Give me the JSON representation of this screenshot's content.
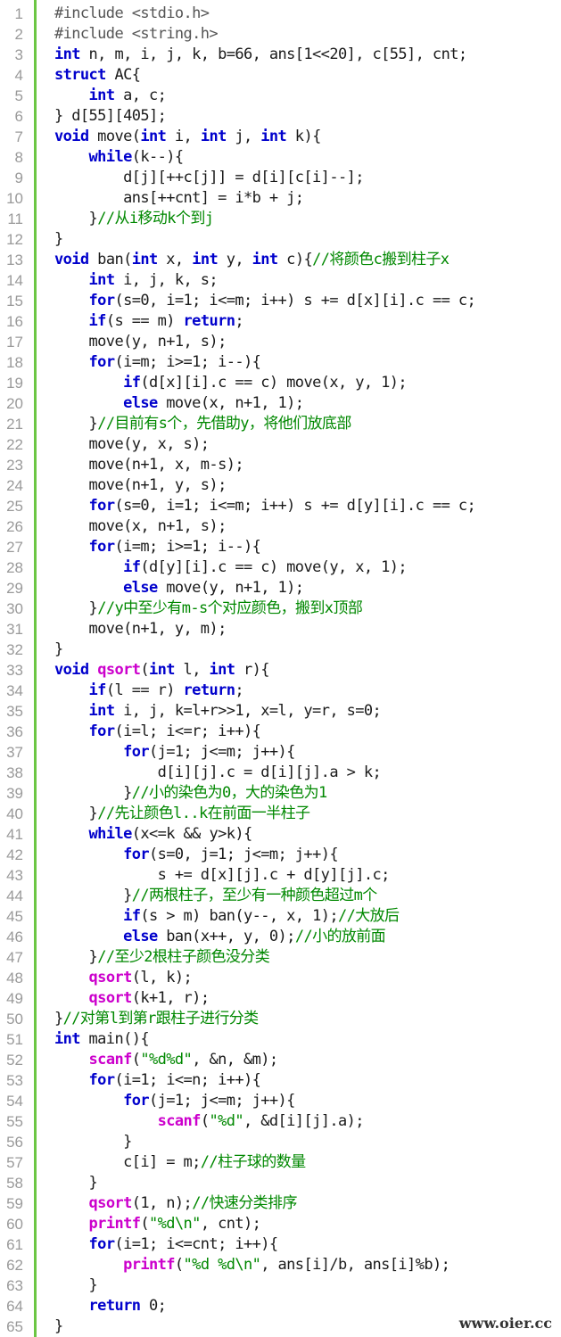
{
  "watermark": "www.oier.cc",
  "lines": [
    {
      "n": "1",
      "t": [
        {
          "c": "pp",
          "s": "#include <stdio.h>"
        }
      ]
    },
    {
      "n": "2",
      "t": [
        {
          "c": "pp",
          "s": "#include <string.h>"
        }
      ]
    },
    {
      "n": "3",
      "t": [
        {
          "c": "kw",
          "s": "int"
        },
        {
          "c": "",
          "s": " n, m, i, j, k, b=66, ans[1<<20], c[55], cnt;"
        }
      ]
    },
    {
      "n": "4",
      "t": [
        {
          "c": "kw",
          "s": "struct"
        },
        {
          "c": "",
          "s": " AC{"
        }
      ]
    },
    {
      "n": "5",
      "t": [
        {
          "c": "",
          "s": "    "
        },
        {
          "c": "kw",
          "s": "int"
        },
        {
          "c": "",
          "s": " a, c;"
        }
      ]
    },
    {
      "n": "6",
      "t": [
        {
          "c": "",
          "s": "} d[55][405];"
        }
      ]
    },
    {
      "n": "7",
      "t": [
        {
          "c": "kw",
          "s": "void"
        },
        {
          "c": "",
          "s": " move("
        },
        {
          "c": "kw",
          "s": "int"
        },
        {
          "c": "",
          "s": " i, "
        },
        {
          "c": "kw",
          "s": "int"
        },
        {
          "c": "",
          "s": " j, "
        },
        {
          "c": "kw",
          "s": "int"
        },
        {
          "c": "",
          "s": " k){"
        }
      ]
    },
    {
      "n": "8",
      "t": [
        {
          "c": "",
          "s": "    "
        },
        {
          "c": "kw",
          "s": "while"
        },
        {
          "c": "",
          "s": "(k--){"
        }
      ]
    },
    {
      "n": "9",
      "t": [
        {
          "c": "",
          "s": "        d[j][++c[j]] = d[i][c[i]--];"
        }
      ]
    },
    {
      "n": "10",
      "t": [
        {
          "c": "",
          "s": "        ans[++cnt] = i*b + j;"
        }
      ]
    },
    {
      "n": "11",
      "t": [
        {
          "c": "",
          "s": "    }"
        },
        {
          "c": "cm",
          "s": "//从i移动k个到j"
        }
      ]
    },
    {
      "n": "12",
      "t": [
        {
          "c": "",
          "s": "}"
        }
      ]
    },
    {
      "n": "13",
      "t": [
        {
          "c": "kw",
          "s": "void"
        },
        {
          "c": "",
          "s": " ban("
        },
        {
          "c": "kw",
          "s": "int"
        },
        {
          "c": "",
          "s": " x, "
        },
        {
          "c": "kw",
          "s": "int"
        },
        {
          "c": "",
          "s": " y, "
        },
        {
          "c": "kw",
          "s": "int"
        },
        {
          "c": "",
          "s": " c){"
        },
        {
          "c": "cm",
          "s": "//将颜色c搬到柱子x"
        }
      ]
    },
    {
      "n": "14",
      "t": [
        {
          "c": "",
          "s": "    "
        },
        {
          "c": "kw",
          "s": "int"
        },
        {
          "c": "",
          "s": " i, j, k, s;"
        }
      ]
    },
    {
      "n": "15",
      "t": [
        {
          "c": "",
          "s": "    "
        },
        {
          "c": "kw",
          "s": "for"
        },
        {
          "c": "",
          "s": "(s=0, i=1; i<=m; i++) s += d[x][i].c == c;"
        }
      ]
    },
    {
      "n": "16",
      "t": [
        {
          "c": "",
          "s": "    "
        },
        {
          "c": "kw",
          "s": "if"
        },
        {
          "c": "",
          "s": "(s == m) "
        },
        {
          "c": "kw",
          "s": "return"
        },
        {
          "c": "",
          "s": ";"
        }
      ]
    },
    {
      "n": "17",
      "t": [
        {
          "c": "",
          "s": "    move(y, n+1, s);"
        }
      ]
    },
    {
      "n": "18",
      "t": [
        {
          "c": "",
          "s": "    "
        },
        {
          "c": "kw",
          "s": "for"
        },
        {
          "c": "",
          "s": "(i=m; i>=1; i--){"
        }
      ]
    },
    {
      "n": "19",
      "t": [
        {
          "c": "",
          "s": "        "
        },
        {
          "c": "kw",
          "s": "if"
        },
        {
          "c": "",
          "s": "(d[x][i].c == c) move(x, y, 1);"
        }
      ]
    },
    {
      "n": "20",
      "t": [
        {
          "c": "",
          "s": "        "
        },
        {
          "c": "kw",
          "s": "else"
        },
        {
          "c": "",
          "s": " move(x, n+1, 1);"
        }
      ]
    },
    {
      "n": "21",
      "t": [
        {
          "c": "",
          "s": "    }"
        },
        {
          "c": "cm",
          "s": "//目前有s个，先借助y，将他们放底部"
        }
      ]
    },
    {
      "n": "22",
      "t": [
        {
          "c": "",
          "s": "    move(y, x, s);"
        }
      ]
    },
    {
      "n": "23",
      "t": [
        {
          "c": "",
          "s": "    move(n+1, x, m-s);"
        }
      ]
    },
    {
      "n": "24",
      "t": [
        {
          "c": "",
          "s": "    move(n+1, y, s);"
        }
      ]
    },
    {
      "n": "25",
      "t": [
        {
          "c": "",
          "s": "    "
        },
        {
          "c": "kw",
          "s": "for"
        },
        {
          "c": "",
          "s": "(s=0, i=1; i<=m; i++) s += d[y][i].c == c;"
        }
      ]
    },
    {
      "n": "26",
      "t": [
        {
          "c": "",
          "s": "    move(x, n+1, s);"
        }
      ]
    },
    {
      "n": "27",
      "t": [
        {
          "c": "",
          "s": "    "
        },
        {
          "c": "kw",
          "s": "for"
        },
        {
          "c": "",
          "s": "(i=m; i>=1; i--){"
        }
      ]
    },
    {
      "n": "28",
      "t": [
        {
          "c": "",
          "s": "        "
        },
        {
          "c": "kw",
          "s": "if"
        },
        {
          "c": "",
          "s": "(d[y][i].c == c) move(y, x, 1);"
        }
      ]
    },
    {
      "n": "29",
      "t": [
        {
          "c": "",
          "s": "        "
        },
        {
          "c": "kw",
          "s": "else"
        },
        {
          "c": "",
          "s": " move(y, n+1, 1);"
        }
      ]
    },
    {
      "n": "30",
      "t": [
        {
          "c": "",
          "s": "    }"
        },
        {
          "c": "cm",
          "s": "//y中至少有m-s个对应颜色，搬到x顶部"
        }
      ]
    },
    {
      "n": "31",
      "t": [
        {
          "c": "",
          "s": "    move(n+1, y, m);"
        }
      ]
    },
    {
      "n": "32",
      "t": [
        {
          "c": "",
          "s": "}"
        }
      ]
    },
    {
      "n": "33",
      "t": [
        {
          "c": "kw",
          "s": "void"
        },
        {
          "c": "",
          "s": " "
        },
        {
          "c": "fn",
          "s": "qsort"
        },
        {
          "c": "",
          "s": "("
        },
        {
          "c": "kw",
          "s": "int"
        },
        {
          "c": "",
          "s": " l, "
        },
        {
          "c": "kw",
          "s": "int"
        },
        {
          "c": "",
          "s": " r){"
        }
      ]
    },
    {
      "n": "34",
      "t": [
        {
          "c": "",
          "s": "    "
        },
        {
          "c": "kw",
          "s": "if"
        },
        {
          "c": "",
          "s": "(l == r) "
        },
        {
          "c": "kw",
          "s": "return"
        },
        {
          "c": "",
          "s": ";"
        }
      ]
    },
    {
      "n": "35",
      "t": [
        {
          "c": "",
          "s": "    "
        },
        {
          "c": "kw",
          "s": "int"
        },
        {
          "c": "",
          "s": " i, j, k=l+r>>1, x=l, y=r, s=0;"
        }
      ]
    },
    {
      "n": "36",
      "t": [
        {
          "c": "",
          "s": "    "
        },
        {
          "c": "kw",
          "s": "for"
        },
        {
          "c": "",
          "s": "(i=l; i<=r; i++){"
        }
      ]
    },
    {
      "n": "37",
      "t": [
        {
          "c": "",
          "s": "        "
        },
        {
          "c": "kw",
          "s": "for"
        },
        {
          "c": "",
          "s": "(j=1; j<=m; j++){"
        }
      ]
    },
    {
      "n": "38",
      "t": [
        {
          "c": "",
          "s": "            d[i][j].c = d[i][j].a > k;"
        }
      ]
    },
    {
      "n": "39",
      "t": [
        {
          "c": "",
          "s": "        }"
        },
        {
          "c": "cm",
          "s": "//小的染色为0，大的染色为1"
        }
      ]
    },
    {
      "n": "40",
      "t": [
        {
          "c": "",
          "s": "    }"
        },
        {
          "c": "cm",
          "s": "//先让颜色l..k在前面一半柱子"
        }
      ]
    },
    {
      "n": "41",
      "t": [
        {
          "c": "",
          "s": "    "
        },
        {
          "c": "kw",
          "s": "while"
        },
        {
          "c": "",
          "s": "(x<=k && y>k){"
        }
      ]
    },
    {
      "n": "42",
      "t": [
        {
          "c": "",
          "s": "        "
        },
        {
          "c": "kw",
          "s": "for"
        },
        {
          "c": "",
          "s": "(s=0, j=1; j<=m; j++){"
        }
      ]
    },
    {
      "n": "43",
      "t": [
        {
          "c": "",
          "s": "            s += d[x][j].c + d[y][j].c;"
        }
      ]
    },
    {
      "n": "44",
      "t": [
        {
          "c": "",
          "s": "        }"
        },
        {
          "c": "cm",
          "s": "//两根柱子，至少有一种颜色超过m个"
        }
      ]
    },
    {
      "n": "45",
      "t": [
        {
          "c": "",
          "s": "        "
        },
        {
          "c": "kw",
          "s": "if"
        },
        {
          "c": "",
          "s": "(s > m) ban(y--, x, 1);"
        },
        {
          "c": "cm",
          "s": "//大放后"
        }
      ]
    },
    {
      "n": "46",
      "t": [
        {
          "c": "",
          "s": "        "
        },
        {
          "c": "kw",
          "s": "else"
        },
        {
          "c": "",
          "s": " ban(x++, y, 0);"
        },
        {
          "c": "cm",
          "s": "//小的放前面"
        }
      ]
    },
    {
      "n": "47",
      "t": [
        {
          "c": "",
          "s": "    }"
        },
        {
          "c": "cm",
          "s": "//至少2根柱子颜色没分类"
        }
      ]
    },
    {
      "n": "48",
      "t": [
        {
          "c": "",
          "s": "    "
        },
        {
          "c": "fn",
          "s": "qsort"
        },
        {
          "c": "",
          "s": "(l, k);"
        }
      ]
    },
    {
      "n": "49",
      "t": [
        {
          "c": "",
          "s": "    "
        },
        {
          "c": "fn",
          "s": "qsort"
        },
        {
          "c": "",
          "s": "(k+1, r);"
        }
      ]
    },
    {
      "n": "50",
      "t": [
        {
          "c": "",
          "s": "}"
        },
        {
          "c": "cm",
          "s": "//对第l到第r跟柱子进行分类"
        }
      ]
    },
    {
      "n": "51",
      "t": [
        {
          "c": "kw",
          "s": "int"
        },
        {
          "c": "",
          "s": " main(){"
        }
      ]
    },
    {
      "n": "52",
      "t": [
        {
          "c": "",
          "s": "    "
        },
        {
          "c": "fn",
          "s": "scanf"
        },
        {
          "c": "",
          "s": "("
        },
        {
          "c": "str",
          "s": "\"%d%d\""
        },
        {
          "c": "",
          "s": ", &n, &m);"
        }
      ]
    },
    {
      "n": "53",
      "t": [
        {
          "c": "",
          "s": "    "
        },
        {
          "c": "kw",
          "s": "for"
        },
        {
          "c": "",
          "s": "(i=1; i<=n; i++){"
        }
      ]
    },
    {
      "n": "54",
      "t": [
        {
          "c": "",
          "s": "        "
        },
        {
          "c": "kw",
          "s": "for"
        },
        {
          "c": "",
          "s": "(j=1; j<=m; j++){"
        }
      ]
    },
    {
      "n": "55",
      "t": [
        {
          "c": "",
          "s": "            "
        },
        {
          "c": "fn",
          "s": "scanf"
        },
        {
          "c": "",
          "s": "("
        },
        {
          "c": "str",
          "s": "\"%d\""
        },
        {
          "c": "",
          "s": ", &d[i][j].a);"
        }
      ]
    },
    {
      "n": "56",
      "t": [
        {
          "c": "",
          "s": "        }"
        }
      ]
    },
    {
      "n": "57",
      "t": [
        {
          "c": "",
          "s": "        c[i] = m;"
        },
        {
          "c": "cm",
          "s": "//柱子球的数量"
        }
      ]
    },
    {
      "n": "58",
      "t": [
        {
          "c": "",
          "s": "    }"
        }
      ]
    },
    {
      "n": "59",
      "t": [
        {
          "c": "",
          "s": "    "
        },
        {
          "c": "fn",
          "s": "qsort"
        },
        {
          "c": "",
          "s": "(1, n);"
        },
        {
          "c": "cm",
          "s": "//快速分类排序"
        }
      ]
    },
    {
      "n": "60",
      "t": [
        {
          "c": "",
          "s": "    "
        },
        {
          "c": "fn",
          "s": "printf"
        },
        {
          "c": "",
          "s": "("
        },
        {
          "c": "str",
          "s": "\"%d\\n\""
        },
        {
          "c": "",
          "s": ", cnt);"
        }
      ]
    },
    {
      "n": "61",
      "t": [
        {
          "c": "",
          "s": "    "
        },
        {
          "c": "kw",
          "s": "for"
        },
        {
          "c": "",
          "s": "(i=1; i<=cnt; i++){"
        }
      ]
    },
    {
      "n": "62",
      "t": [
        {
          "c": "",
          "s": "        "
        },
        {
          "c": "fn",
          "s": "printf"
        },
        {
          "c": "",
          "s": "("
        },
        {
          "c": "str",
          "s": "\"%d %d\\n\""
        },
        {
          "c": "",
          "s": ", ans[i]/b, ans[i]%b);"
        }
      ]
    },
    {
      "n": "63",
      "t": [
        {
          "c": "",
          "s": "    }"
        }
      ]
    },
    {
      "n": "64",
      "t": [
        {
          "c": "",
          "s": "    "
        },
        {
          "c": "kw",
          "s": "return"
        },
        {
          "c": "",
          "s": " 0;"
        }
      ]
    },
    {
      "n": "65",
      "t": [
        {
          "c": "",
          "s": "}"
        }
      ]
    }
  ]
}
